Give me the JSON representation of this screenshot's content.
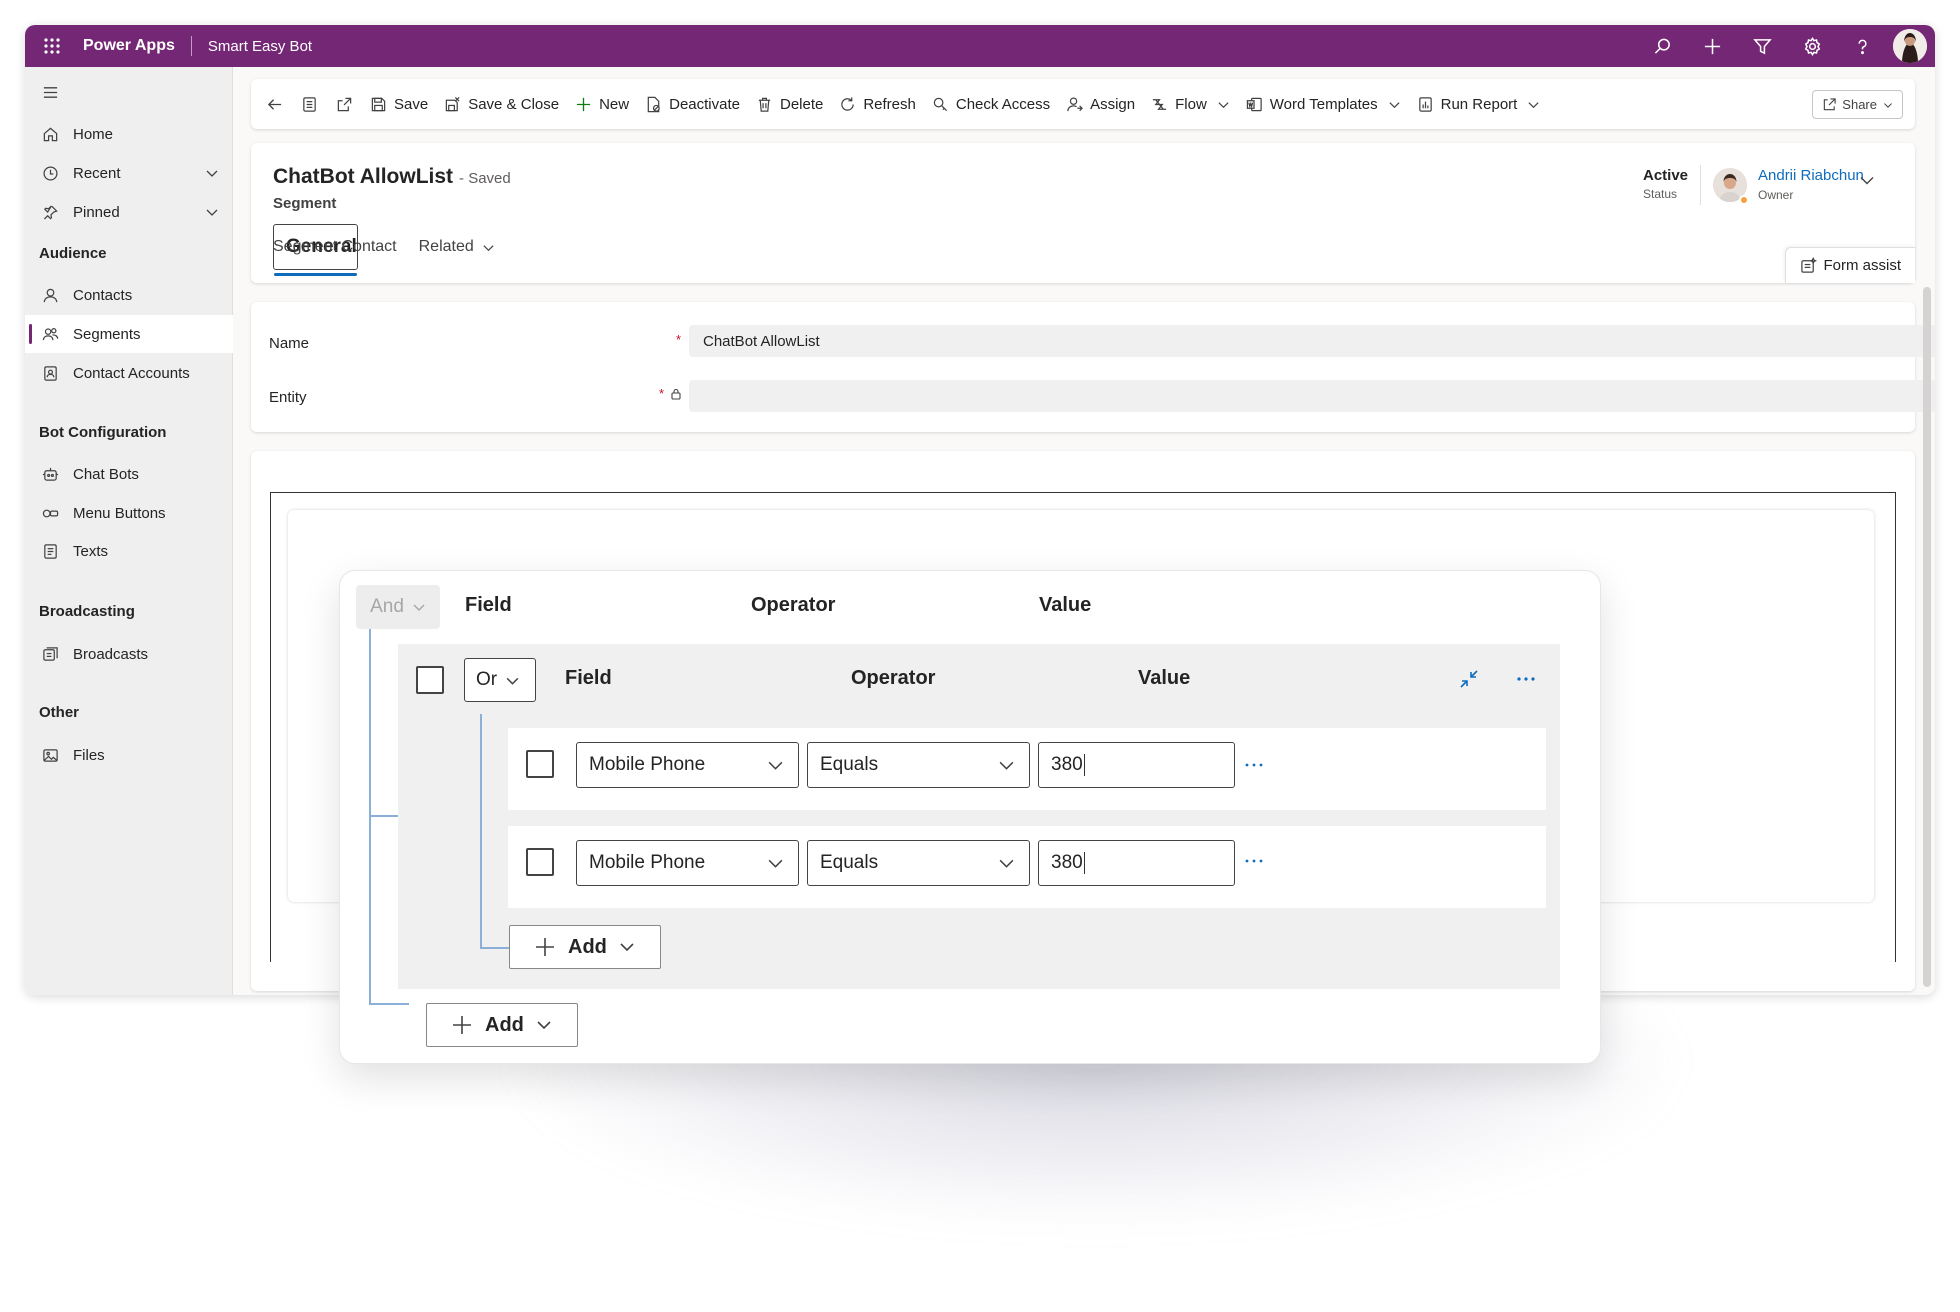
{
  "topbar": {
    "app_name": "Power Apps",
    "environment": "Smart Easy Bot",
    "icons": [
      "waffle-icon",
      "search-icon",
      "plus-icon",
      "filter-icon",
      "settings-icon",
      "help-icon"
    ]
  },
  "sidebar": {
    "items": [
      {
        "label": "Home",
        "icon": "home-icon"
      },
      {
        "label": "Recent",
        "icon": "clock-icon"
      },
      {
        "label": "Pinned",
        "icon": "pin-icon"
      }
    ],
    "sections": [
      {
        "title": "Audience",
        "items": [
          {
            "label": "Contacts",
            "icon": "person-icon"
          },
          {
            "label": "Segments",
            "icon": "people-icon",
            "active": true
          },
          {
            "label": "Contact Accounts",
            "icon": "contact-card-icon"
          }
        ]
      },
      {
        "title": "Bot Configuration",
        "items": [
          {
            "label": "Chat Bots",
            "icon": "bot-icon"
          },
          {
            "label": "Menu Buttons",
            "icon": "buttons-icon"
          },
          {
            "label": "Texts",
            "icon": "text-icon"
          }
        ]
      },
      {
        "title": "Broadcasting",
        "items": [
          {
            "label": "Broadcasts",
            "icon": "broadcast-icon"
          }
        ]
      },
      {
        "title": "Other",
        "items": [
          {
            "label": "Files",
            "icon": "image-icon"
          }
        ]
      }
    ]
  },
  "commandbar": {
    "save": "Save",
    "save_close": "Save & Close",
    "new": "New",
    "deactivate": "Deactivate",
    "delete": "Delete",
    "refresh": "Refresh",
    "check_access": "Check Access",
    "assign": "Assign",
    "flow": "Flow",
    "word_templates": "Word Templates",
    "run_report": "Run Report",
    "share": "Share"
  },
  "record": {
    "title": "ChatBot AllowList",
    "save_state": "- Saved",
    "entity": "Segment",
    "status_value": "Active",
    "status_label": "Status",
    "owner_name": "Andrii Riabchun",
    "owner_label": "Owner",
    "tabs": [
      "General",
      "Segment Contact",
      "Related"
    ],
    "form_assist": "Form assist"
  },
  "form": {
    "name_label": "Name",
    "name_value": "ChatBot AllowList",
    "entity_label": "Entity",
    "entity_value": ""
  },
  "query_builder": {
    "root_operator": "And",
    "headers": {
      "field": "Field",
      "operator": "Operator",
      "value": "Value"
    },
    "group": {
      "operator": "Or",
      "rows": [
        {
          "field": "Mobile Phone",
          "operator": "Equals",
          "value": "380"
        },
        {
          "field": "Mobile Phone",
          "operator": "Equals",
          "value": "380"
        }
      ],
      "add_label": "Add"
    },
    "add_label": "Add"
  },
  "colors": {
    "brand": "#742774",
    "link": "#0f6cbd",
    "tree_line": "#8ab0d8"
  }
}
